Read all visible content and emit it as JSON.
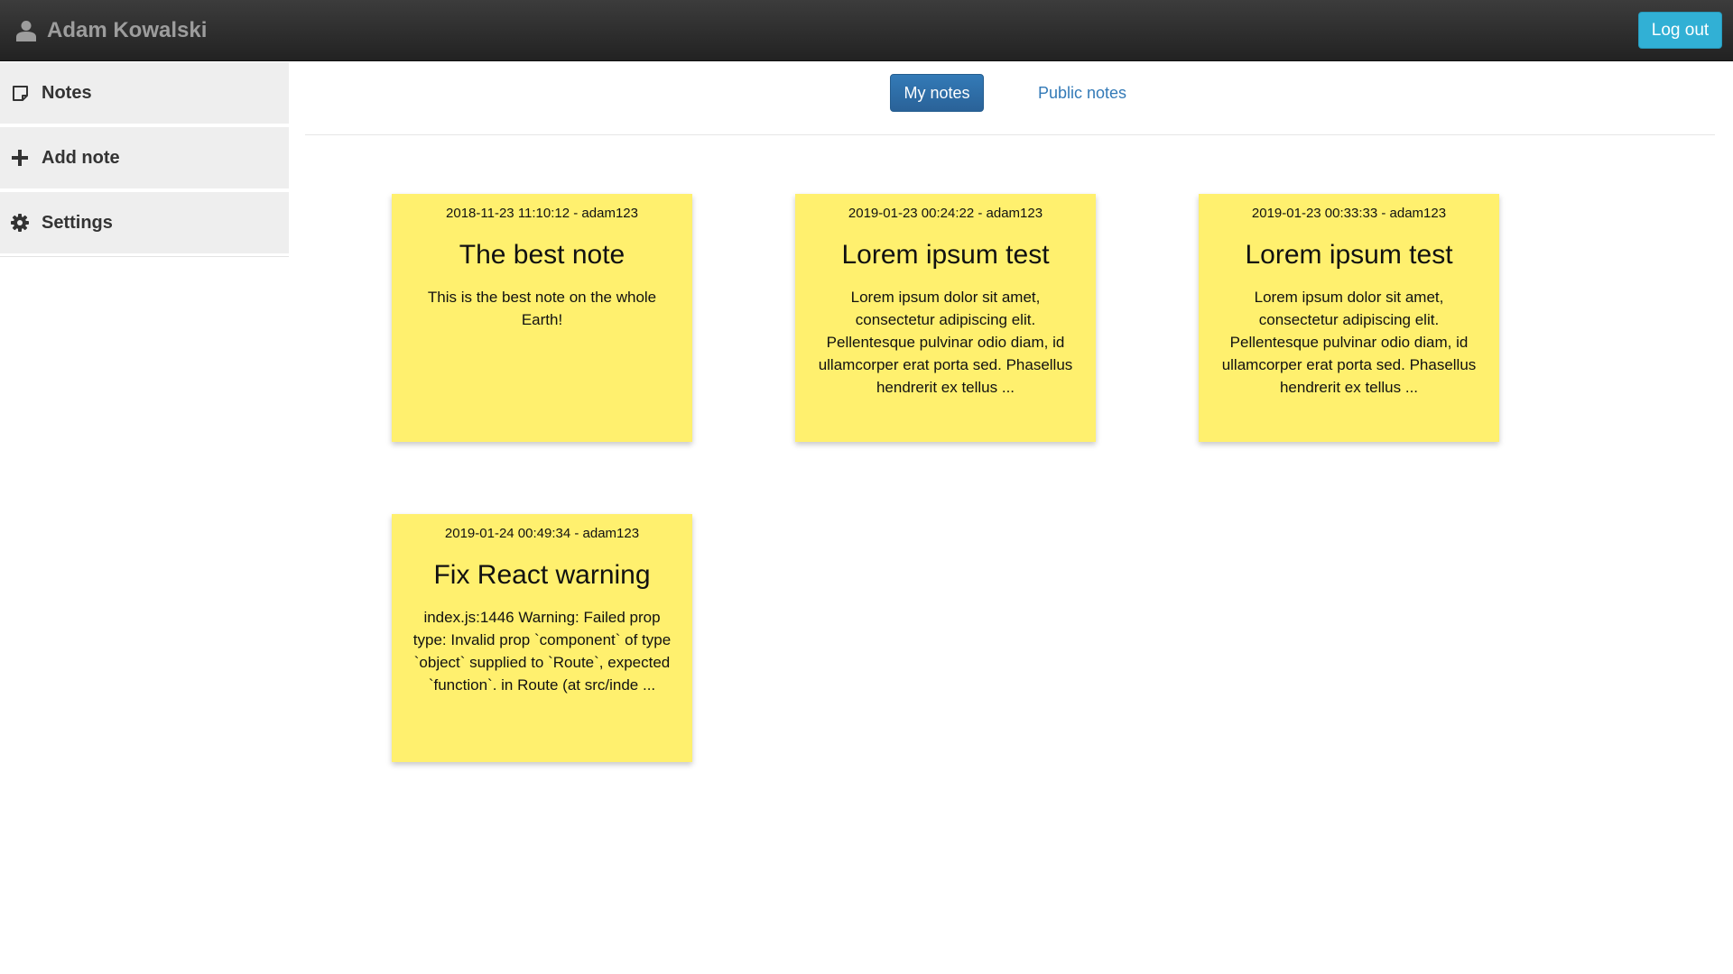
{
  "header": {
    "user_icon": "user-icon",
    "user_name": "Adam Kowalski",
    "logout_label": "Log out"
  },
  "sidebar": {
    "items": [
      {
        "icon": "sticky-note-icon",
        "label": "Notes"
      },
      {
        "icon": "plus-icon",
        "label": "Add note"
      },
      {
        "icon": "gear-icon",
        "label": "Settings"
      }
    ]
  },
  "tabs": {
    "active": "My notes",
    "my_notes_label": "My notes",
    "public_notes_label": "Public notes"
  },
  "colors": {
    "note_background": "#fff06e",
    "active_tab": "#337ab7",
    "logout_button": "#31b0d5",
    "topbar": "#2b2b2b"
  },
  "notes": [
    {
      "meta": "2018-11-23 11:10:12 - adam123",
      "title": "The best note",
      "body": "This is the best note on the whole Earth!"
    },
    {
      "meta": "2019-01-23 00:24:22 - adam123",
      "title": "Lorem ipsum test",
      "body": "Lorem ipsum dolor sit amet, consectetur adipiscing elit. Pellentesque pulvinar odio diam, id ullamcorper erat porta sed. Phasellus hendrerit ex tellus ..."
    },
    {
      "meta": "2019-01-23 00:33:33 - adam123",
      "title": "Lorem ipsum test",
      "body": "Lorem ipsum dolor sit amet, consectetur adipiscing elit. Pellentesque pulvinar odio diam, id ullamcorper erat porta sed. Phasellus hendrerit ex tellus ..."
    },
    {
      "meta": "2019-01-24 00:49:34 - adam123",
      "title": "Fix React warning",
      "body": "index.js:1446 Warning: Failed prop type: Invalid prop `component` of type `object` supplied to `Route`, expected `function`. in Route (at src/inde ..."
    }
  ]
}
